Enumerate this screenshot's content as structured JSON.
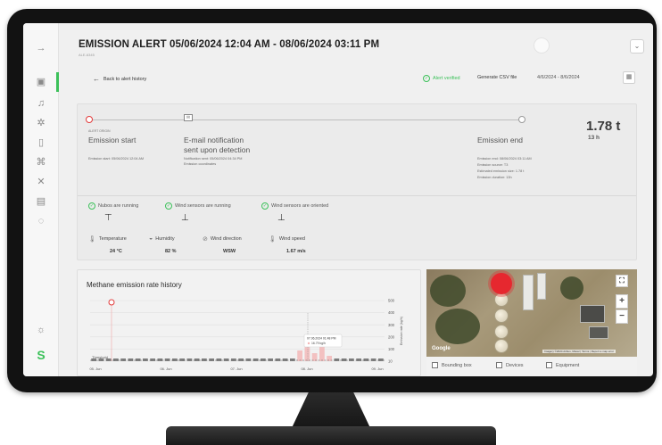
{
  "header": {
    "title": "EMISSION ALERT 05/06/2024 12:04 AM - 08/06/2024 03:11 PM",
    "subtitle": "ALE-6345"
  },
  "toolbar": {
    "back_label": "Back to alert history",
    "verified_label": "Alert verified",
    "csv_label": "Generate CSV file",
    "date_range": "4/6/2024 - 8/6/2024"
  },
  "timeline": {
    "start": {
      "tag": "ALERT ORIGIN",
      "title": "Emission start",
      "meta": [
        "Emission start: 05/06/2024 12:04 AM"
      ]
    },
    "notification": {
      "title_line1": "E-mail notification",
      "title_line2": "sent upon detection",
      "meta": [
        "Notification sent: 05/06/2024 04:34 PM",
        "Emission coordinates"
      ]
    },
    "end": {
      "title": "Emission end",
      "meta": [
        "Emission end: 08/06/2024 03:11 AM",
        "Emission source: T3",
        "Estimated emission size: 1.78 t",
        "Emission duration: 13h"
      ]
    },
    "total_value": "1.78 t",
    "total_duration": "13 h"
  },
  "status": [
    {
      "label": "Nubos are running"
    },
    {
      "label": "Wind sensors are running"
    },
    {
      "label": "Wind sensors are oriented"
    }
  ],
  "weather": [
    {
      "label": "Temperature",
      "value": "24 °C",
      "icon": "thermometer-icon"
    },
    {
      "label": "Humidity",
      "value": "82 %",
      "icon": "droplet-icon"
    },
    {
      "label": "Wind direction",
      "value": "WSW",
      "icon": "compass-icon"
    },
    {
      "label": "Wind speed",
      "value": "1.67 m/s",
      "icon": "thermometer-icon"
    }
  ],
  "chart_data": {
    "type": "bar",
    "title": "Methane emission rate history",
    "ylabel": "Emission rate (kg/h)",
    "y_ticks": [
      "500",
      "400",
      "300",
      "200",
      "100",
      "10"
    ],
    "x_ticks": [
      "05. Jun",
      "06. Jun",
      "07. Jun",
      "08. Jun",
      "09. Jun"
    ],
    "threshold_label": "Threshold",
    "tooltip_line1": "07.06.2024 01:48 PM",
    "tooltip_line2": "16.79 kg/h",
    "ylim": [
      0,
      500
    ],
    "series_values": [
      10,
      10,
      10,
      10,
      10,
      10,
      10,
      10,
      10,
      10,
      10,
      10,
      10,
      10,
      10,
      10,
      10,
      10,
      10,
      10,
      10,
      10,
      10,
      10,
      10,
      10,
      10,
      10,
      40,
      70,
      30,
      55,
      20,
      10,
      10,
      10,
      10,
      10,
      10,
      10
    ]
  },
  "map": {
    "google_label": "Google",
    "attribution": "Imagery ©2024 Airbus, Maxar  |  Terms  |  Report a map error",
    "zoom_in": "+",
    "zoom_out": "−",
    "fullscreen": "⛶",
    "checkboxes": [
      "Bounding box",
      "Devices",
      "Equipment"
    ]
  },
  "colors": {
    "accent": "#3cc15a",
    "alert": "#e23b3b"
  }
}
